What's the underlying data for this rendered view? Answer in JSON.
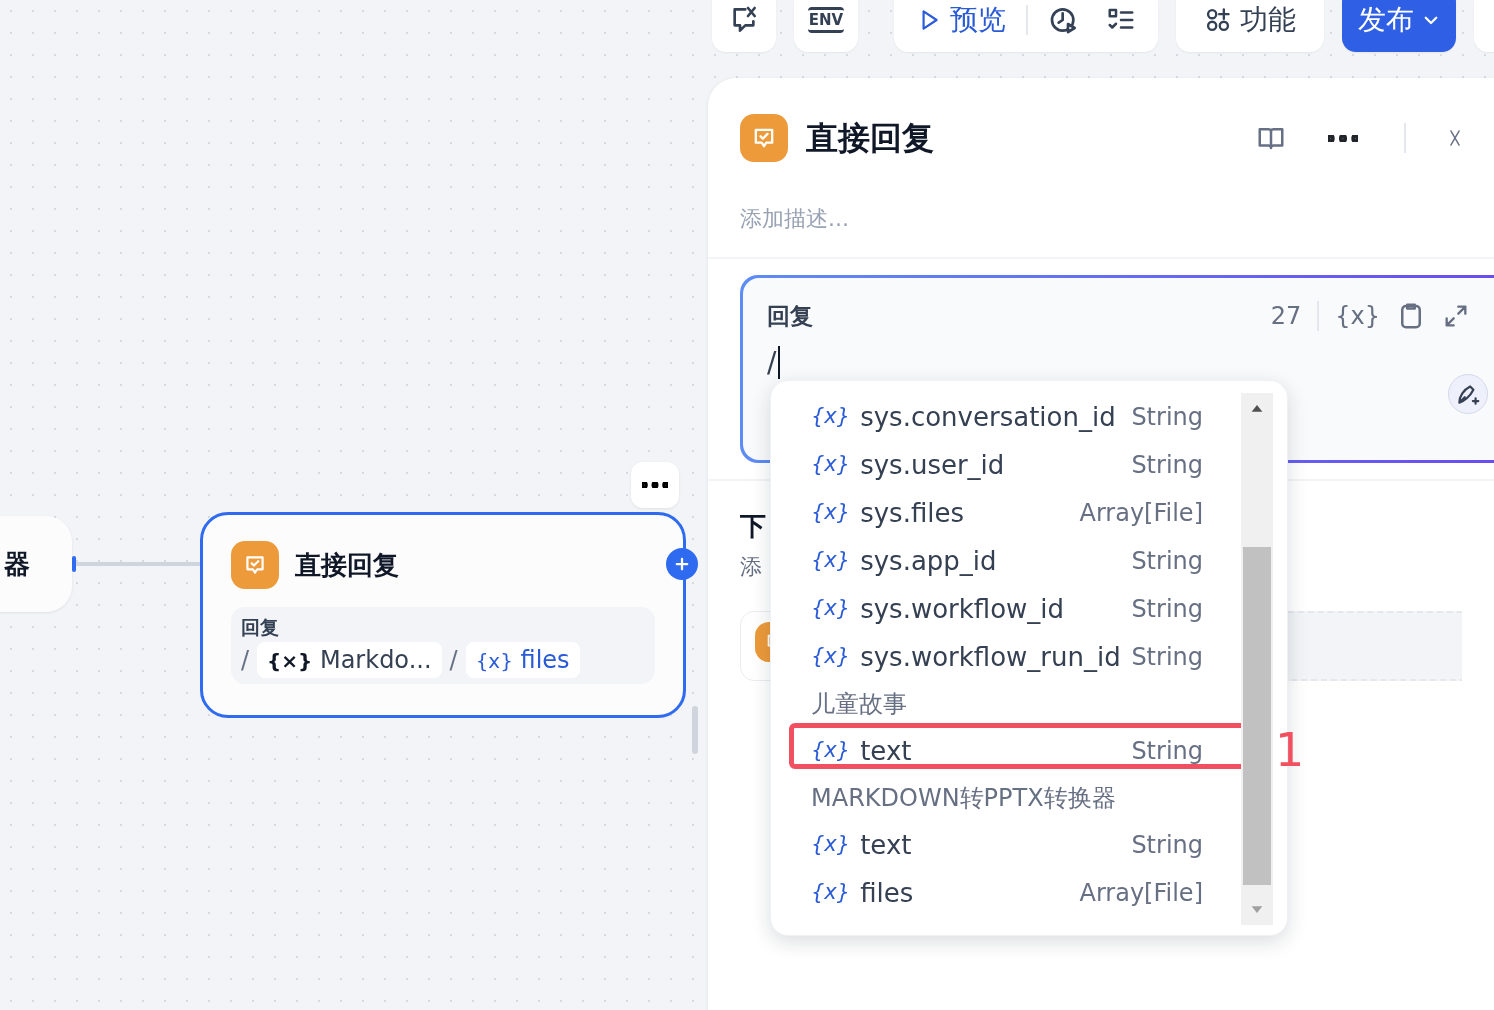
{
  "toolbar": {
    "env": "ENV",
    "preview": "预览",
    "features": "功能",
    "publish": "发布"
  },
  "canvas": {
    "left_node": {
      "title": "器"
    },
    "node": {
      "title": "直接回复",
      "selected": true,
      "field_label": "回复",
      "content": [
        {
          "kind": "text",
          "text": "/"
        },
        {
          "kind": "chip",
          "icon": "{×}",
          "text": "Markdo...",
          "active": false
        },
        {
          "kind": "text",
          "text": "/"
        },
        {
          "kind": "chip",
          "icon": "{x}",
          "text": "files",
          "active": true
        }
      ]
    }
  },
  "panel": {
    "title": "直接回复",
    "description_placeholder": "添加描述...",
    "editor": {
      "label": "回复",
      "count": "27",
      "value": "/",
      "icon_text": "{x}"
    },
    "next_step": {
      "title": "下",
      "description": "添"
    }
  },
  "dropdown": {
    "sections": [
      {
        "items": [
          {
            "icon": "{x}",
            "name": "sys.conversation_id",
            "type": "String",
            "marked": false
          },
          {
            "icon": "{x}",
            "name": "sys.user_id",
            "type": "String",
            "marked": false
          },
          {
            "icon": "{x}",
            "name": "sys.files",
            "type": "Array[File]",
            "marked": false
          },
          {
            "icon": "{x}",
            "name": "sys.app_id",
            "type": "String",
            "marked": false
          },
          {
            "icon": "{x}",
            "name": "sys.workflow_id",
            "type": "String",
            "marked": false
          },
          {
            "icon": "{x}",
            "name": "sys.workflow_run_id",
            "type": "String",
            "marked": false
          }
        ]
      },
      {
        "title": "儿童故事",
        "items": [
          {
            "icon": "{x}",
            "name": "text",
            "type": "String",
            "marked": true
          }
        ]
      },
      {
        "title": "MARKDOWN转PPTX转换器",
        "items": [
          {
            "icon": "{x}",
            "name": "text",
            "type": "String",
            "marked": false
          },
          {
            "icon": "{x}",
            "name": "files",
            "type": "Array[File]",
            "marked": false
          }
        ]
      }
    ]
  },
  "annotation": {
    "label": "1"
  }
}
